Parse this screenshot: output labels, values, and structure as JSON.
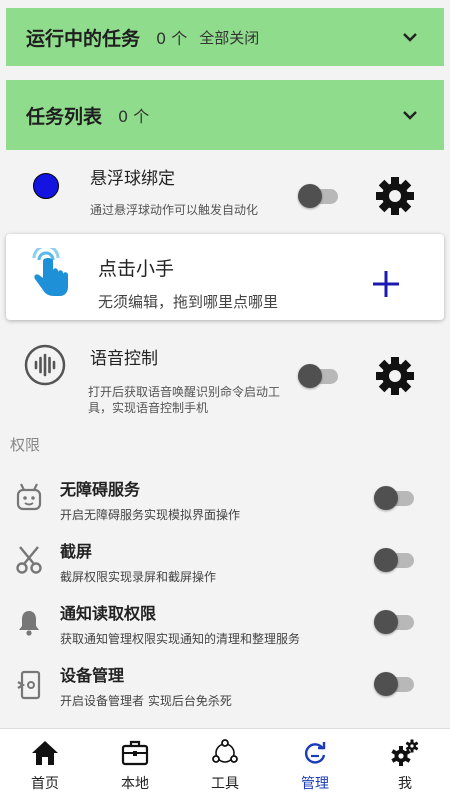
{
  "running": {
    "title": "运行中的任务",
    "count": "0 个",
    "close_all": "全部关闭"
  },
  "tasklist": {
    "title": "任务列表",
    "count": "0 个"
  },
  "items": [
    {
      "title": "悬浮球绑定",
      "desc": "通过悬浮球动作可以触发自动化"
    },
    {
      "title": "点击小手",
      "desc": "无须编辑，拖到哪里点哪里"
    },
    {
      "title": "语音控制",
      "desc": "打开后获取语音唤醒识别命令启动工具，实现语音控制手机"
    }
  ],
  "permissions_header": "权限",
  "permissions": [
    {
      "title": "无障碍服务",
      "desc": "开启无障碍服务实现模拟界面操作"
    },
    {
      "title": "截屏",
      "desc": "截屏权限实现录屏和截屏操作"
    },
    {
      "title": "通知读取权限",
      "desc": "获取通知管理权限实现通知的清理和整理服务"
    },
    {
      "title": "设备管理",
      "desc": "开启设备管理者 实现后台免杀死"
    }
  ],
  "tabs": [
    {
      "label": "首页",
      "icon": "home-icon"
    },
    {
      "label": "本地",
      "icon": "briefcase-icon"
    },
    {
      "label": "工具",
      "icon": "tools-icon"
    },
    {
      "label": "管理",
      "icon": "manage-icon"
    },
    {
      "label": "我",
      "icon": "gears-icon"
    }
  ],
  "active_tab": "管理",
  "colors": {
    "header_green": "#8fdc8c",
    "active_blue": "#1a3cb8",
    "dot_blue": "#1414e0"
  }
}
